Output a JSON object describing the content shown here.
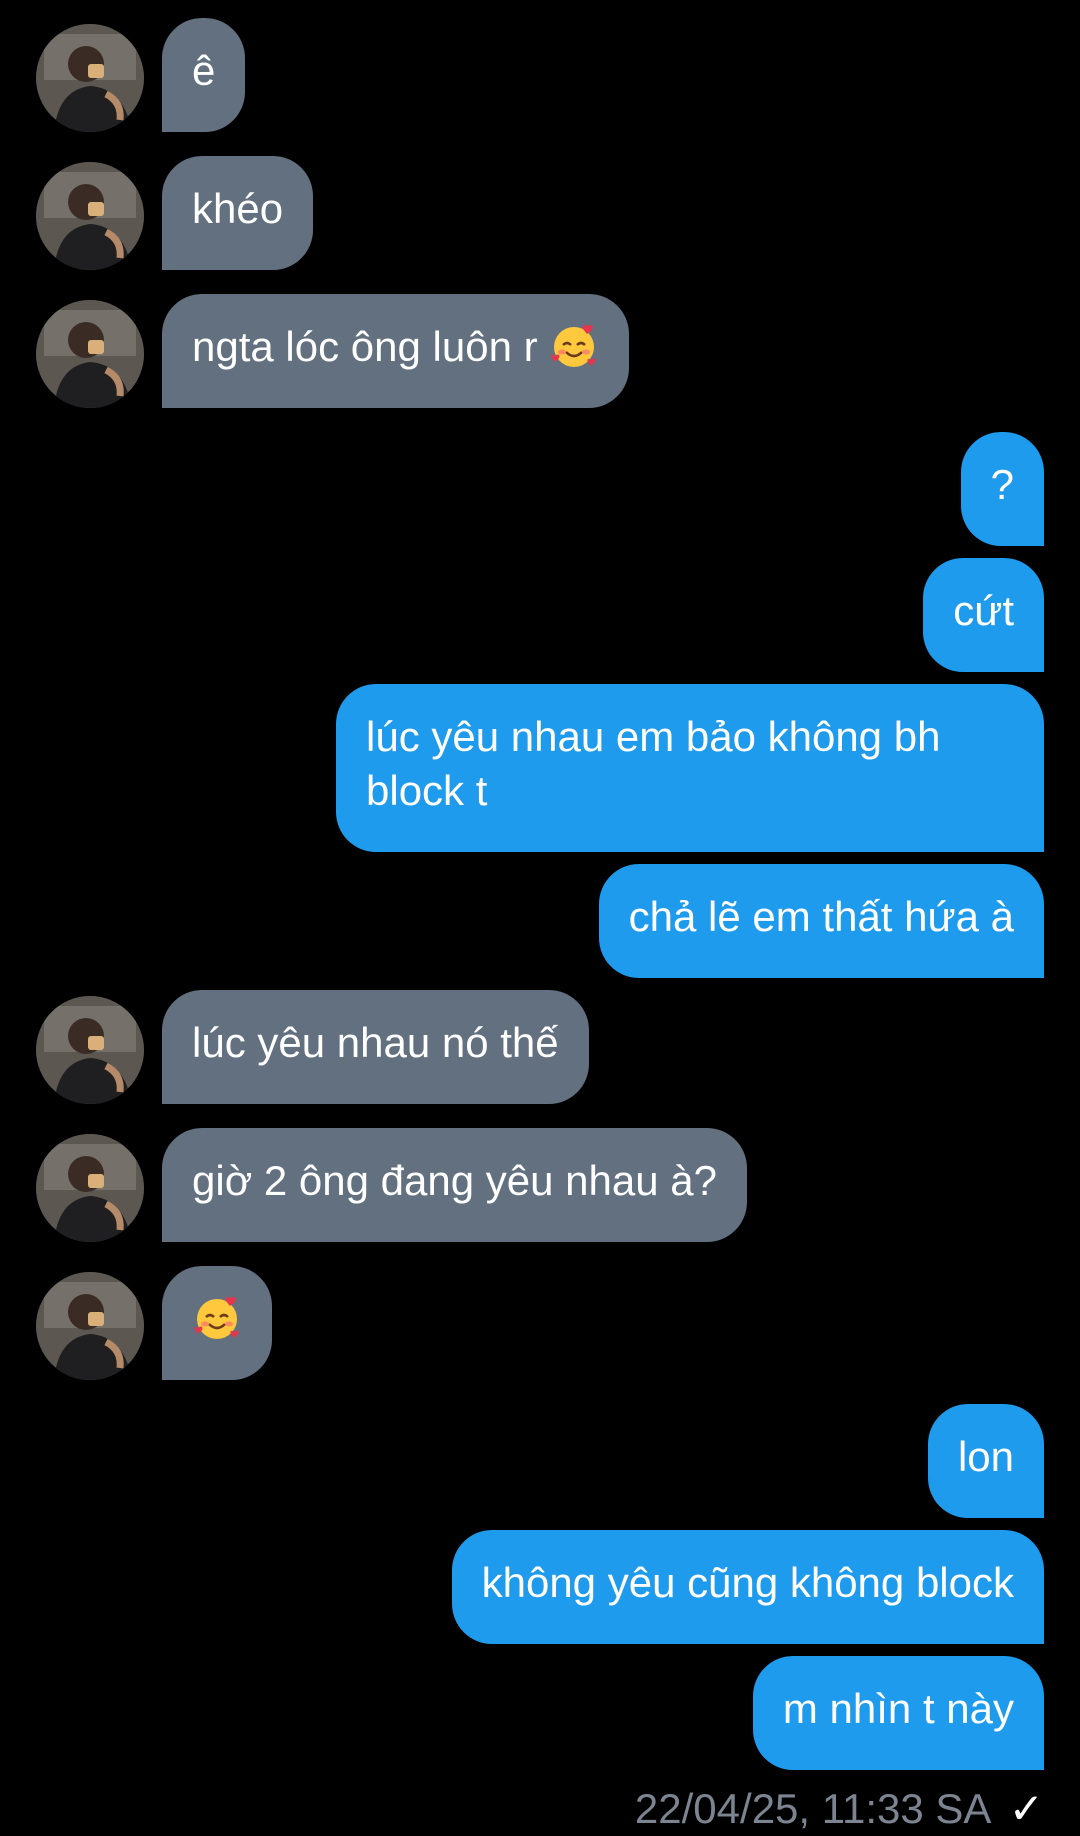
{
  "conversation": {
    "messages": [
      {
        "side": "in",
        "text": "ê",
        "has_emoji": false
      },
      {
        "side": "in",
        "text": "khéo",
        "has_emoji": false
      },
      {
        "side": "in",
        "text": "ngta lóc ông luôn r",
        "has_emoji": true,
        "emoji": "smiling-face-with-hearts"
      },
      {
        "side": "out",
        "text": "?",
        "has_emoji": false
      },
      {
        "side": "out",
        "text": "cứt",
        "has_emoji": false
      },
      {
        "side": "out",
        "text": "lúc yêu nhau em bảo không bh block t",
        "has_emoji": false
      },
      {
        "side": "out",
        "text": "chả lẽ em thất hứa à",
        "has_emoji": false
      },
      {
        "side": "in",
        "text": "lúc yêu nhau nó thế",
        "has_emoji": false
      },
      {
        "side": "in",
        "text": "giờ 2 ông đang yêu nhau à?",
        "has_emoji": false
      },
      {
        "side": "in",
        "text": "",
        "has_emoji": true,
        "emoji": "smiling-face-with-hearts"
      },
      {
        "side": "out",
        "text": "lon",
        "has_emoji": false
      },
      {
        "side": "out",
        "text": "không yêu cũng không block",
        "has_emoji": false
      },
      {
        "side": "out",
        "text": "m nhìn t này",
        "has_emoji": false
      }
    ],
    "timestamp": "22/04/25, 11:33 SA",
    "read_mark": "✓"
  },
  "colors": {
    "background": "#000000",
    "incoming_bubble": "#627080",
    "outgoing_bubble": "#1e9bec",
    "meta_text": "#7b8490"
  },
  "icons": {
    "avatar": "contact-avatar-photo",
    "emoji": "smiling-face-with-hearts-icon",
    "status": "sent-check-icon"
  }
}
